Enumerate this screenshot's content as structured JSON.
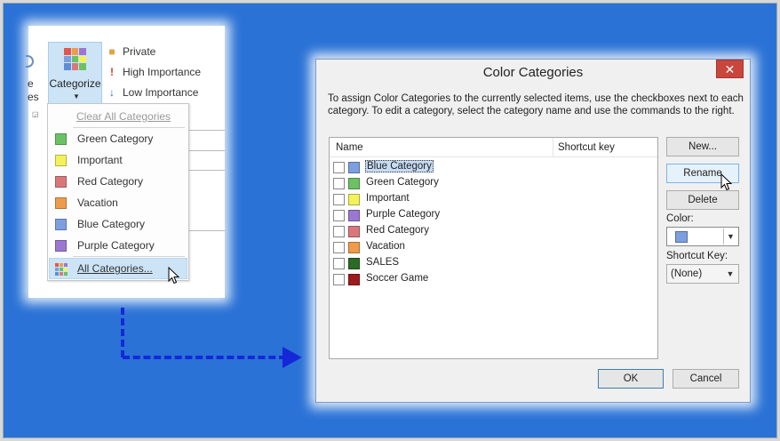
{
  "ribbon": {
    "edge_texts": [
      "e",
      "es"
    ],
    "categorize_label": "Categorize",
    "private_label": "Private",
    "high_importance_label": "High Importance",
    "low_importance_label": "Low Importance"
  },
  "menu": {
    "clear_label": "Clear All Categories",
    "items": [
      {
        "label": "Green Category",
        "color": "#6cc164"
      },
      {
        "label": "Important",
        "color": "#f4f25a"
      },
      {
        "label": "Red Category",
        "color": "#d9787b"
      },
      {
        "label": "Vacation",
        "color": "#ef9b4c"
      },
      {
        "label": "Blue Category",
        "color": "#7d9fdf"
      },
      {
        "label": "Purple Category",
        "color": "#9a78d0"
      }
    ],
    "all_label": "All Categories..."
  },
  "dialog": {
    "title": "Color Categories",
    "close_glyph": "✕",
    "description": "To assign Color Categories to the currently selected items, use the checkboxes next to each category.  To edit a category, select the category name and use the commands to the right.",
    "columns": {
      "name": "Name",
      "shortcut": "Shortcut key"
    },
    "categories": [
      {
        "label": "Blue Category",
        "color": "#7d9fdf",
        "selected": true
      },
      {
        "label": "Green Category",
        "color": "#6cc164"
      },
      {
        "label": "Important",
        "color": "#f4f25a"
      },
      {
        "label": "Purple Category",
        "color": "#9a78d0"
      },
      {
        "label": "Red Category",
        "color": "#d9787b"
      },
      {
        "label": "Vacation",
        "color": "#ef9b4c"
      },
      {
        "label": "SALES",
        "color": "#2c6b25"
      },
      {
        "label": "Soccer Game",
        "color": "#9e1b1b"
      }
    ],
    "buttons": {
      "new": "New...",
      "rename": "Rename",
      "delete": "Delete",
      "ok": "OK",
      "cancel": "Cancel"
    },
    "color_label": "Color:",
    "color_value": "#7d9fdf",
    "shortcut_label": "Shortcut Key:",
    "shortcut_value": "(None)"
  },
  "colors": {
    "background": "#2a72d6",
    "arrow": "#1428d8",
    "highlight": "#cde4f7"
  }
}
